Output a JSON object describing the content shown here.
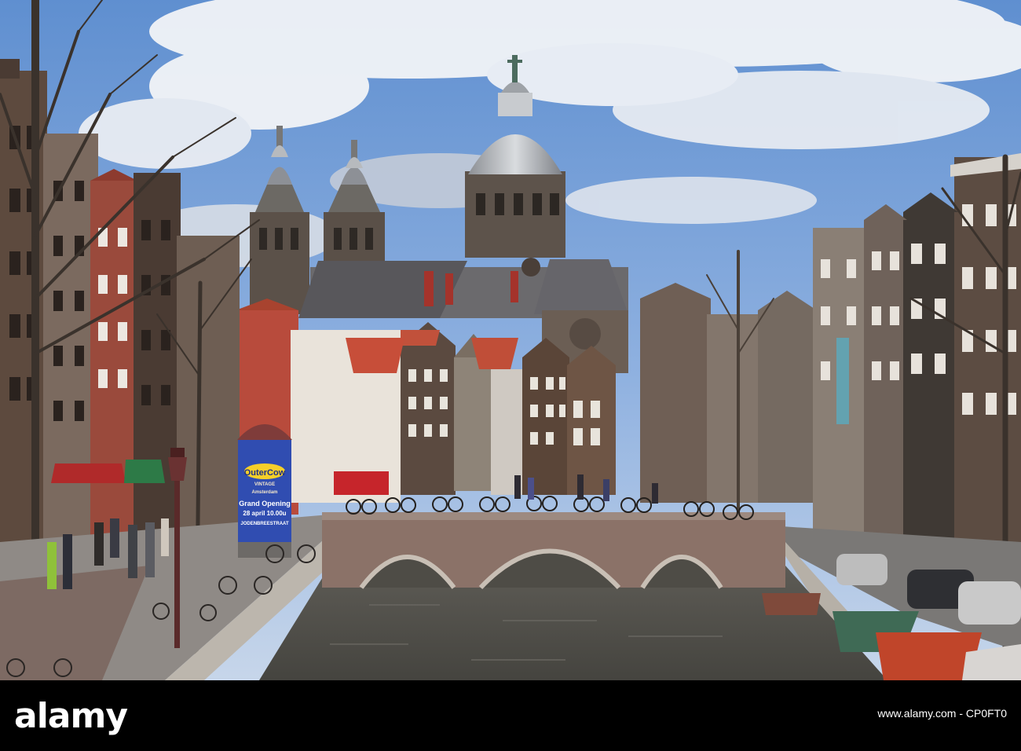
{
  "watermark": {
    "brand": "alamy",
    "image_id_label": "www.alamy.com",
    "image_code": "CP0FT0"
  },
  "poster": {
    "headline": "OuterCow",
    "sub": "VINTAGE",
    "city": "Amsterdam",
    "event": "Grand Opening",
    "date": "28 april 10.00u",
    "street": "JODENBREESTRAAT"
  },
  "colors": {
    "sky": "#6f9ad3",
    "water": "#53524d",
    "footer": "#000000"
  }
}
